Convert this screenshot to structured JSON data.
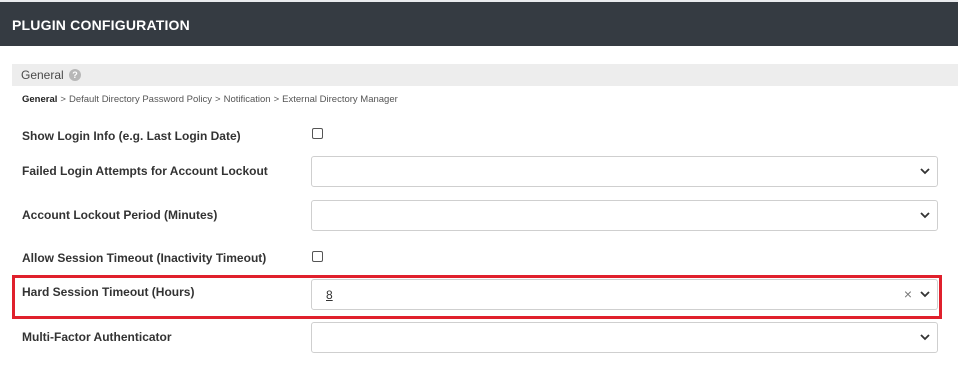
{
  "header": {
    "title": "PLUGIN CONFIGURATION"
  },
  "section": {
    "title": "General",
    "help_icon": "?"
  },
  "breadcrumb": {
    "current": "General",
    "separator": ">",
    "items": [
      "Default Directory Password Policy",
      "Notification",
      "External Directory Manager"
    ]
  },
  "fields": {
    "show_login_info": {
      "label": "Show Login Info (e.g. Last Login Date)",
      "checked": false
    },
    "failed_login_attempts": {
      "label": "Failed Login Attempts for Account Lockout",
      "value": ""
    },
    "account_lockout_period": {
      "label": "Account Lockout Period (Minutes)",
      "value": ""
    },
    "allow_session_timeout": {
      "label": "Allow Session Timeout (Inactivity Timeout)",
      "checked": false
    },
    "hard_session_timeout": {
      "label": "Hard Session Timeout (Hours)",
      "value": "8",
      "clear_icon": "×"
    },
    "multi_factor_authenticator": {
      "label": "Multi-Factor Authenticator",
      "value": ""
    }
  },
  "icons": {
    "help": "help-icon",
    "chevron": "chevron-down-icon",
    "clear": "close-icon"
  },
  "colors": {
    "header_bg": "#353b42",
    "section_bg": "#ededed",
    "highlight": "#e0202c"
  }
}
